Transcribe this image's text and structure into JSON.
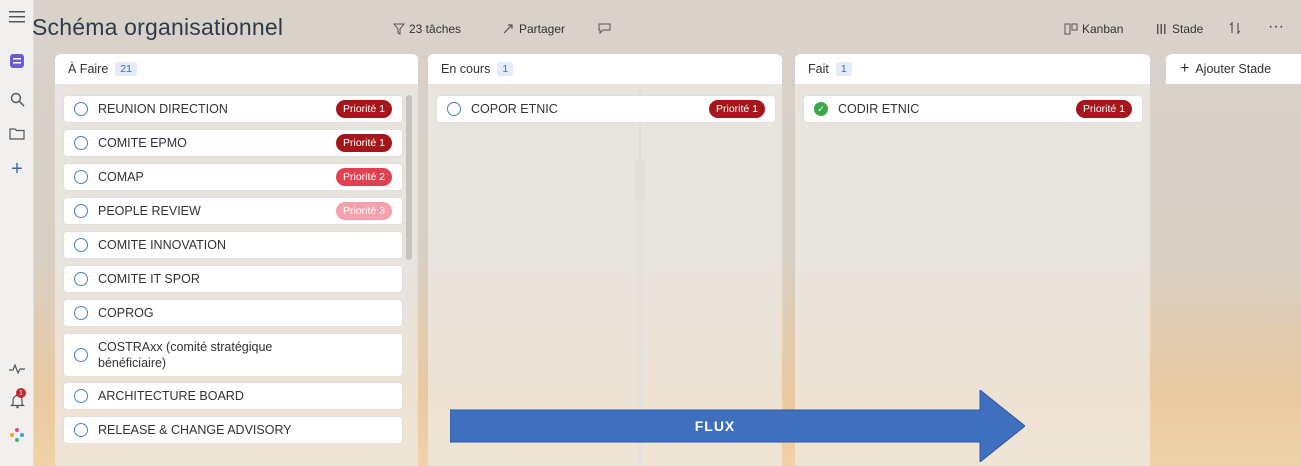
{
  "header": {
    "title": "Schéma organisationnel",
    "tasks_label": "23 tâches",
    "share_label": "Partager",
    "view_label": "Kanban",
    "group_label": "Stade"
  },
  "columns": [
    {
      "title": "À Faire",
      "count": "21",
      "cards": [
        {
          "label": "REUNION DIRECTION",
          "badge": "Priorité 1",
          "level": "p1",
          "done": false
        },
        {
          "label": "COMITE EPMO",
          "badge": "Priorité 1",
          "level": "p1",
          "done": false
        },
        {
          "label": "COMAP",
          "badge": "Priorité 2",
          "level": "p2",
          "done": false
        },
        {
          "label": "PEOPLE REVIEW",
          "badge": "Priorité 3",
          "level": "p3",
          "done": false
        },
        {
          "label": "COMITE INNOVATION",
          "badge": "",
          "level": "",
          "done": false
        },
        {
          "label": "COMITE IT SPOR",
          "badge": "",
          "level": "",
          "done": false
        },
        {
          "label": "COPROG",
          "badge": "",
          "level": "",
          "done": false
        },
        {
          "label": "COSTRAxx (comité stratégique bénéficiaire)",
          "badge": "",
          "level": "",
          "done": false
        },
        {
          "label": "ARCHITECTURE BOARD",
          "badge": "",
          "level": "",
          "done": false
        },
        {
          "label": "RELEASE & CHANGE ADVISORY",
          "badge": "",
          "level": "",
          "done": false
        }
      ]
    },
    {
      "title": "En cours",
      "count": "1",
      "cards": [
        {
          "label": "COPOR ETNIC",
          "badge": "Priorité 1",
          "level": "p1",
          "done": false
        }
      ]
    },
    {
      "title": "Fait",
      "count": "1",
      "cards": [
        {
          "label": "CODIR ETNIC",
          "badge": "Priorité 1",
          "level": "p1",
          "done": true
        }
      ]
    }
  ],
  "add_stage_label": "Ajouter Stade",
  "flow_label": "FLUX",
  "notification_count": "1",
  "colors": {
    "priority1": "#a4161a",
    "priority2": "#e0404f",
    "priority3": "#f4a1ad",
    "accent": "#4a7fc4",
    "flow_arrow": "#3f6fbf"
  },
  "icons": [
    "hamburger-icon",
    "app-icon",
    "search-icon",
    "folder-icon",
    "plus-icon",
    "activity-icon",
    "bell-icon",
    "apps-icon",
    "filter-icon",
    "share-icon",
    "comment-icon",
    "kanban-icon",
    "columns-icon",
    "sort-icon",
    "more-icon"
  ]
}
